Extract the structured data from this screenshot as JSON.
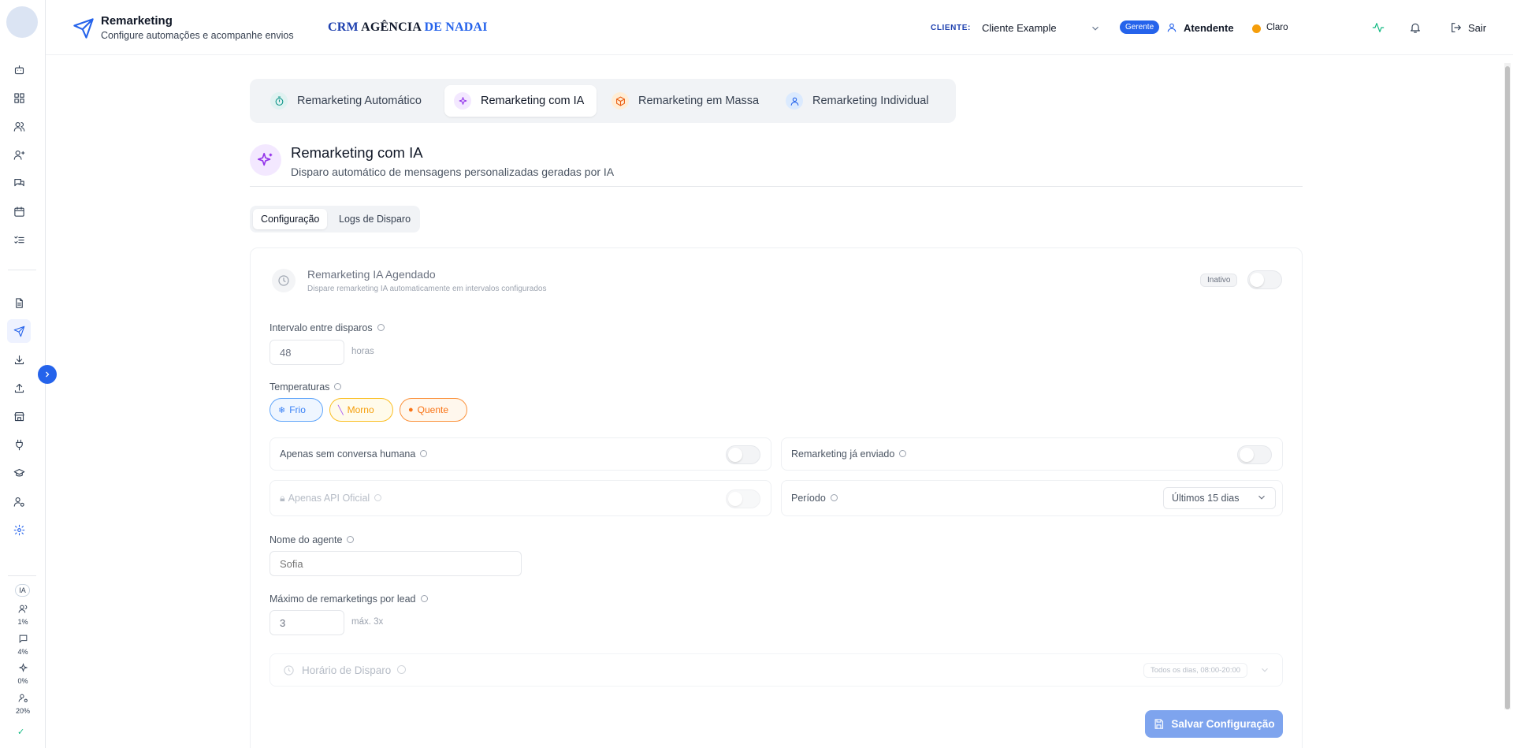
{
  "header": {
    "title": "Remarketing",
    "subtitle": "Configure automações e acompanhe envios",
    "brand_part1": "CRM",
    "brand_part2": "AGÊNCIA",
    "brand_part3": "DE NADAI",
    "cliente_label": "CLIENTE:",
    "cliente_value": "Cliente Example",
    "role_badge": "Gerente",
    "user_role": "Atendente",
    "theme_label": "Claro",
    "logout_label": "Sair"
  },
  "sidebar": {
    "ia_label": "IA",
    "stats": [
      "1%",
      "4%",
      "0%",
      "20%"
    ]
  },
  "tabs": [
    {
      "label": "Remarketing Automático"
    },
    {
      "label": "Remarketing com IA"
    },
    {
      "label": "Remarketing em Massa"
    },
    {
      "label": "Remarketing Individual"
    }
  ],
  "section": {
    "title": "Remarketing com IA",
    "subtitle": "Disparo automático de mensagens personalizadas geradas por IA"
  },
  "subtabs": [
    "Configuração",
    "Logs de Disparo"
  ],
  "scheduled": {
    "title": "Remarketing IA Agendado",
    "subtitle": "Dispare remarketing IA automaticamente em intervalos configurados",
    "status": "Inativo"
  },
  "form": {
    "interval_label": "Intervalo entre disparos",
    "interval_value": "48",
    "interval_unit": "horas",
    "temps_label": "Temperaturas",
    "temps": [
      "Frio",
      "Morno",
      "Quente"
    ],
    "only_no_human": "Apenas sem conversa humana",
    "already_sent": "Remarketing já enviado",
    "only_api": "Apenas API Oficial",
    "period_label": "Período",
    "period_value": "Últimos 15 dias",
    "agent_name_label": "Nome do agente",
    "agent_name_placeholder": "Sofia",
    "max_label": "Máximo de remarketings por lead",
    "max_value": "3",
    "max_unit": "máx. 3x",
    "schedule_title": "Horário de Disparo",
    "schedule_tag": "Todos os dias, 08:00-20:00",
    "save_label": "Salvar Configuração"
  },
  "colors": {
    "primary": "#2563eb",
    "ai_purple": "#9333ea",
    "frio": "#3b82f6",
    "morno": "#f59e0b",
    "quente": "#f97316"
  }
}
